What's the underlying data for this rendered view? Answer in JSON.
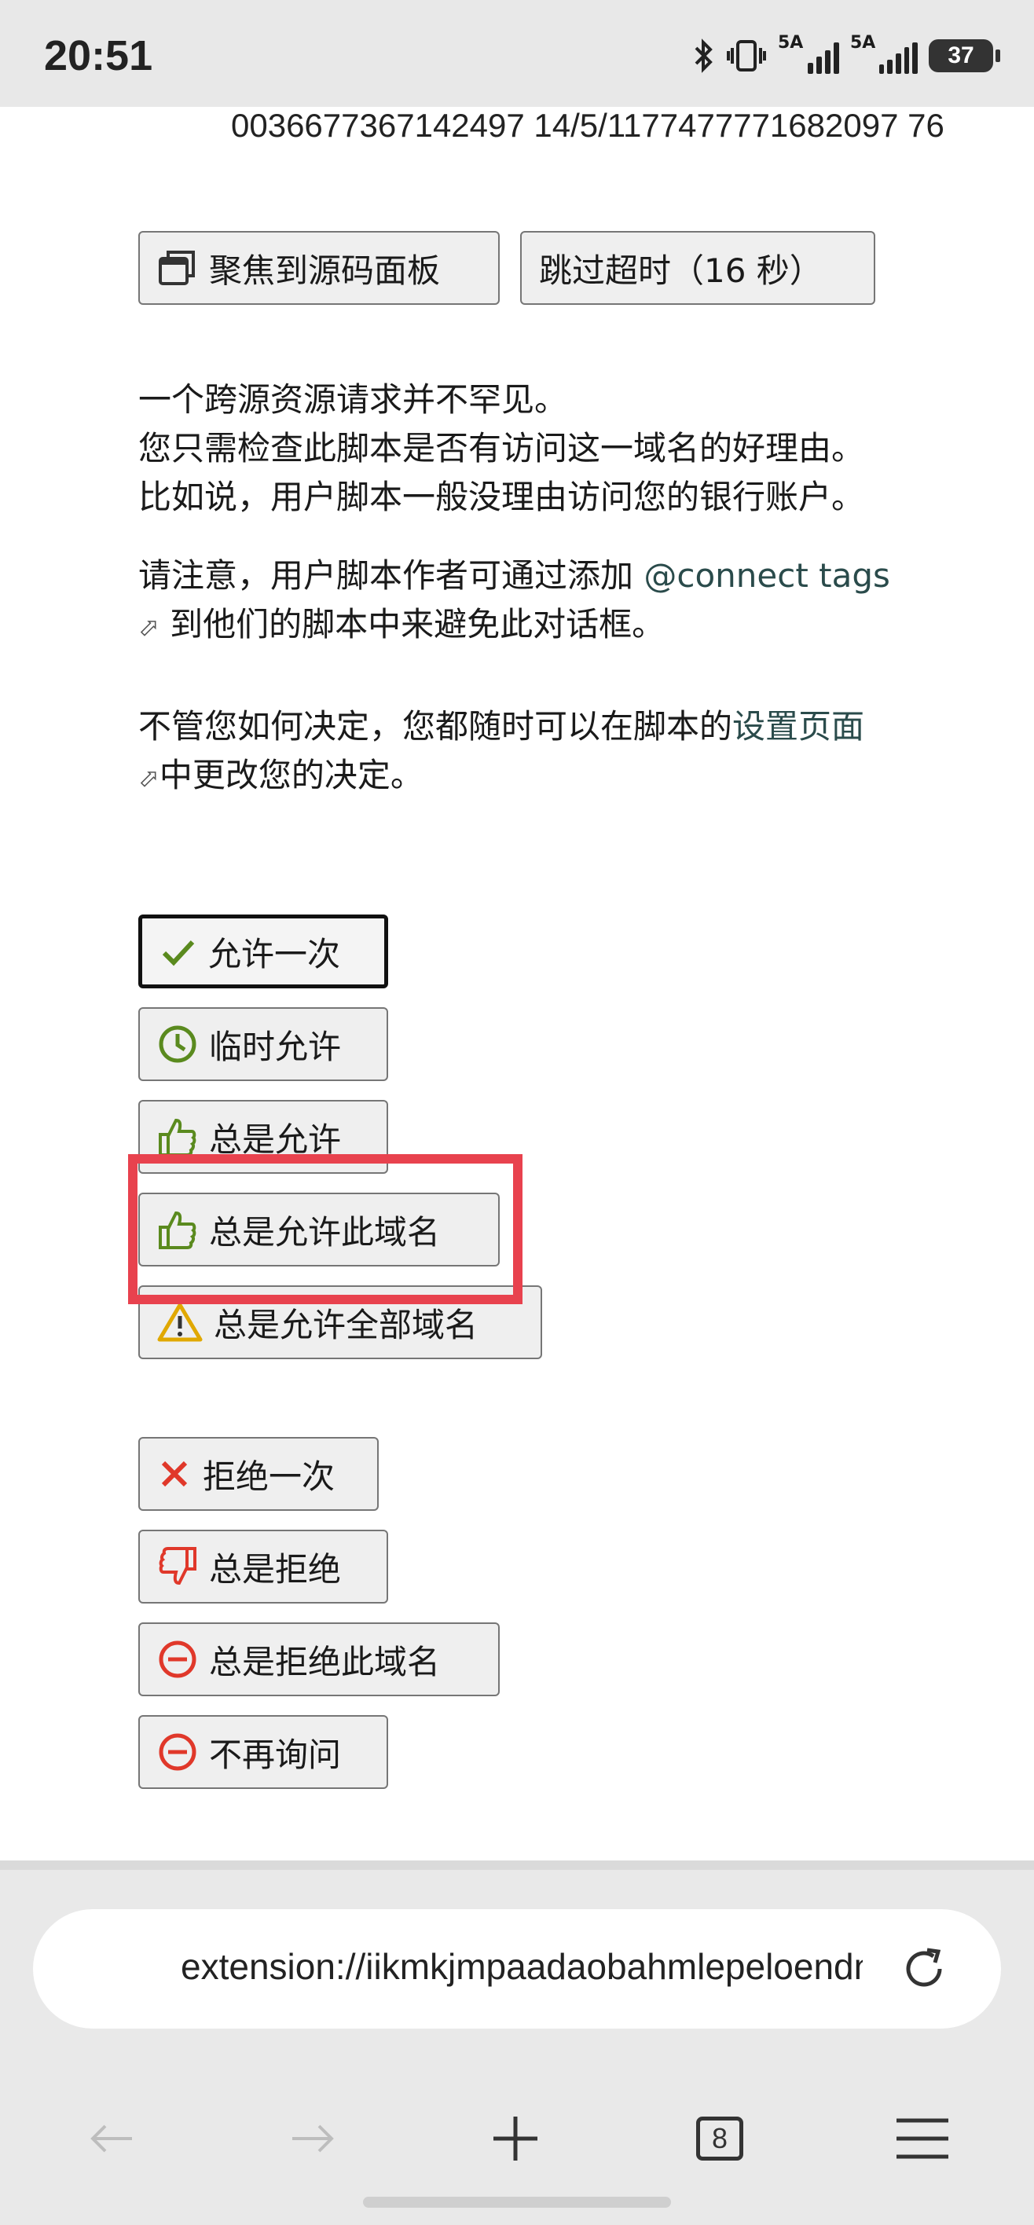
{
  "status_bar": {
    "time": "20:51",
    "signal1_label": "5A",
    "signal2_label": "5A",
    "battery": "37",
    "icons": [
      "bluetooth-icon",
      "vibrate-icon",
      "signal-icon",
      "signal-icon",
      "battery-icon"
    ]
  },
  "page": {
    "top_text": "0036677367142497 14/5/1177477771682097 76",
    "focus_button": "聚焦到源码面板",
    "skip_timeout_button": "跳过超时（16 秒）",
    "para1": [
      "一个跨源资源请求并不罕见。",
      "您只需检查此脚本是否有访问这一域名的好理由。",
      "比如说，用户脚本一般没理由访问您的银行账户。"
    ],
    "para2_prefix": "请注意，用户脚本作者可通过添加",
    "para2_link": "@connect tags",
    "para2_suffix": "到他们的脚本中来避免此对话框。",
    "para3_prefix": "不管您如何决定，您都随时可以在脚本的",
    "para3_link": "设置页面",
    "para3_suffix": "中更改您的决定。",
    "external_link_icon": "⬀",
    "actions": {
      "allow_once": "允许一次",
      "allow_temporarily": "临时允许",
      "always_allow": "总是允许",
      "always_allow_domain": "总是允许此域名",
      "always_allow_all": "总是允许全部域名",
      "deny_once": "拒绝一次",
      "always_deny": "总是拒绝",
      "always_deny_domain": "总是拒绝此域名",
      "never_ask": "不再询问"
    },
    "colors": {
      "allow_green": "#5a8a1e",
      "warning_yellow": "#e0a800",
      "deny_red": "#e0382a",
      "highlight_red": "#e8424e"
    }
  },
  "browser": {
    "url": "extension://iikmkjmpaadaobahmlepeloendndfphd",
    "tab_count": "8"
  }
}
